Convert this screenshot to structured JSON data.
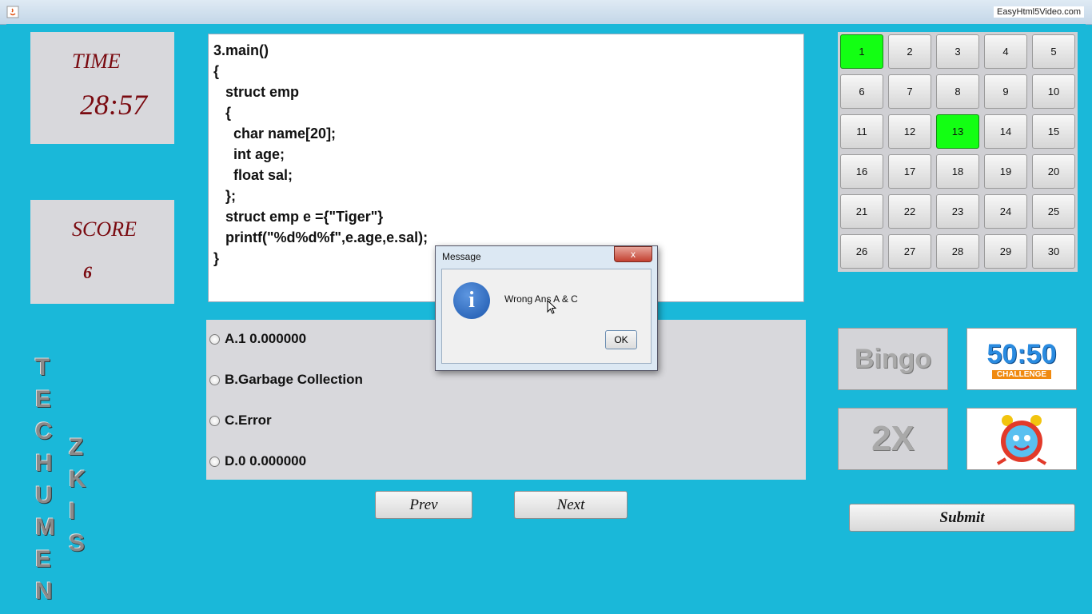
{
  "window": {
    "watermark": "EasyHtml5Video.com"
  },
  "timer": {
    "title": "TIME",
    "value": "28:57"
  },
  "score": {
    "title": "SCORE",
    "value": "6"
  },
  "question": {
    "lines": [
      "3.main()",
      "{",
      "   struct emp",
      "   {",
      "     char name[20];",
      "     int age;",
      "     float sal;",
      "   };",
      "   struct emp e ={\"Tiger\"}",
      "   printf(\"%d%d%f\",e.age,e.sal);",
      "}"
    ]
  },
  "options": [
    {
      "label": "A.1 0.000000"
    },
    {
      "label": "B.Garbage Collection"
    },
    {
      "label": "C.Error"
    },
    {
      "label": "D.0 0.000000"
    }
  ],
  "nav": {
    "prev": "Prev",
    "next": "Next",
    "submit": "Submit"
  },
  "question_grid": {
    "numbers": [
      "1",
      "2",
      "3",
      "4",
      "5",
      "6",
      "7",
      "8",
      "9",
      "10",
      "11",
      "12",
      "13",
      "14",
      "15",
      "16",
      "17",
      "18",
      "19",
      "20",
      "21",
      "22",
      "23",
      "24",
      "25",
      "26",
      "27",
      "28",
      "29",
      "30"
    ],
    "answered": [
      "1",
      "13"
    ],
    "answered_color": "#13ff13"
  },
  "lifelines": {
    "bingo": "Bingo",
    "fifty": "50:50",
    "fifty_sub": "CHALLENGE",
    "double": "2X"
  },
  "team": {
    "word1": "TECHUMEN",
    "word2": "ZKIS"
  },
  "dialog": {
    "title": "Message",
    "message": "Wrong Ans A & C",
    "ok": "OK",
    "close": "x"
  }
}
